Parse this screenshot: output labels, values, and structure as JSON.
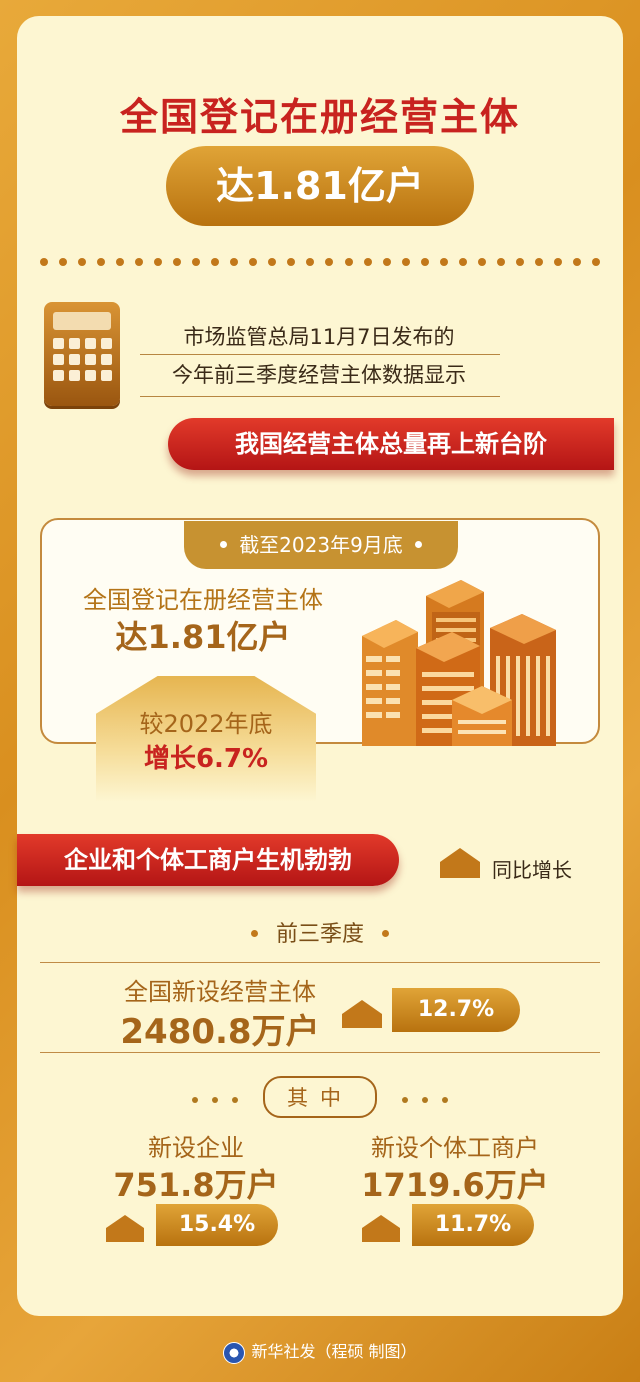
{
  "header": {
    "title": "全国登记在册经营主体",
    "highlight": "达1.81亿户"
  },
  "intro": {
    "line1": "市场监管总局11月7日发布的",
    "line2": "今年前三季度经营主体数据显示"
  },
  "banner1": "我国经营主体总量再上新台阶",
  "total_box": {
    "date_tag": "截至2023年9月底",
    "label": "全国登记在册经营主体",
    "value": "达1.81亿户",
    "compare_label": "较2022年底",
    "growth": "增长6.7%"
  },
  "banner2": "企业和个体工商户生机勃勃",
  "legend_yoy": "同比增长",
  "quarter": {
    "label": "前三季度",
    "new_label": "全国新设经营主体",
    "new_value": "2480.8万户",
    "new_growth": "12.7%"
  },
  "among": "其中",
  "breakdown": [
    {
      "label": "新设企业",
      "value": "751.8万户",
      "growth": "15.4%"
    },
    {
      "label": "新设个体工商户",
      "value": "1719.6万户",
      "growth": "11.7%"
    }
  ],
  "footer": "新华社发（程硕 制图）",
  "colors": {
    "red": "#c8231f",
    "gold": "#c79231",
    "brown": "#a5651a",
    "cream": "#fdf6d2",
    "frame": "#e0a437"
  },
  "icons": [
    "calculator-icon",
    "buildings-illustration",
    "up-arrow-icon",
    "xinhua-logo-icon"
  ]
}
